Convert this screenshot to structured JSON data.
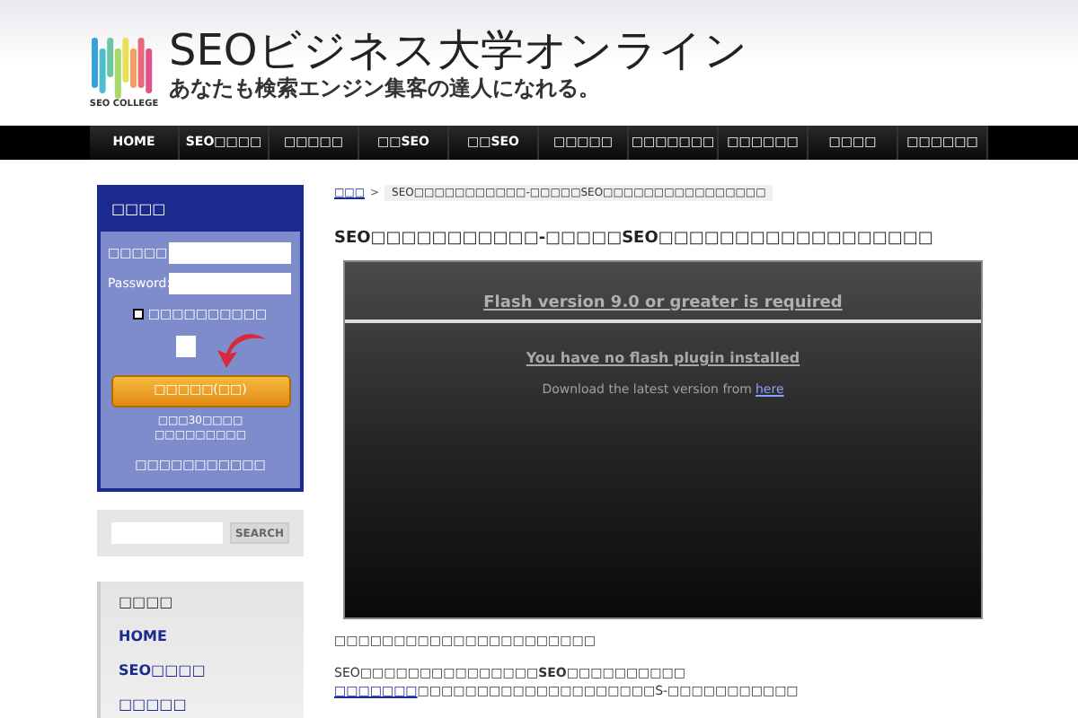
{
  "header": {
    "logo_caption": "SEO COLLEGE",
    "title": "SEOビジネス大学オンライン",
    "tagline": "あなたも検索エンジン集客の達人になれる。"
  },
  "nav": [
    {
      "label": "HOME",
      "selected": false
    },
    {
      "label": "SEO□□□□",
      "selected": false
    },
    {
      "label": "□□□□□",
      "selected": false
    },
    {
      "label": "□□SEO",
      "selected": false
    },
    {
      "label": "□□SEO",
      "selected": false
    },
    {
      "label": "□□□□□",
      "selected": false
    },
    {
      "label": "□□□□□□□",
      "selected": false
    },
    {
      "label": "□□□□□□",
      "selected": false
    },
    {
      "label": "□□□□",
      "selected": false
    },
    {
      "label": "□□□□□□",
      "selected": false
    }
  ],
  "login": {
    "title": "□□□□",
    "user_label": "□□□□□",
    "password_label": "Password:",
    "remember": {
      "label": "□□□□□□□□□□",
      "checked": false
    },
    "button": "□□□□□(□□)",
    "note_lines": [
      "□□□30□□□□",
      "□□□□□□□□□"
    ],
    "footer_link": "□□□□□□□□□□□"
  },
  "search": {
    "button": "SEARCH"
  },
  "menu": {
    "title": "□□□□",
    "items": [
      "HOME",
      "SEO□□□□",
      "□□□□□"
    ]
  },
  "breadcrumb": {
    "home": "□□□",
    "separator": ">",
    "current": "SEO□□□□□□□□□□□-□□□□□SEO□□□□□□□□□□□□□□□□"
  },
  "page_title": "SEO□□□□□□□□□□□-□□□□□SEO□□□□□□□□□□□□□□□□□□",
  "flash": {
    "heading": "Flash version 9.0 or greater is required",
    "message": "You have no flash plugin installed",
    "download_text": "Download the latest version from",
    "download_link": "here"
  },
  "paragraphs": [
    {
      "text": "□□□□□□□□□□□□□□□□□□□□□□"
    },
    {
      "text": "SEO□□□□□□□□□□□□□□□**SEO**□□□□□□□□□□"
    },
    {
      "link": "□□□□□□□",
      "text": "□□□□□□□□□□□□□□□□□□□□S-□□□□□□□□□□□"
    }
  ]
}
